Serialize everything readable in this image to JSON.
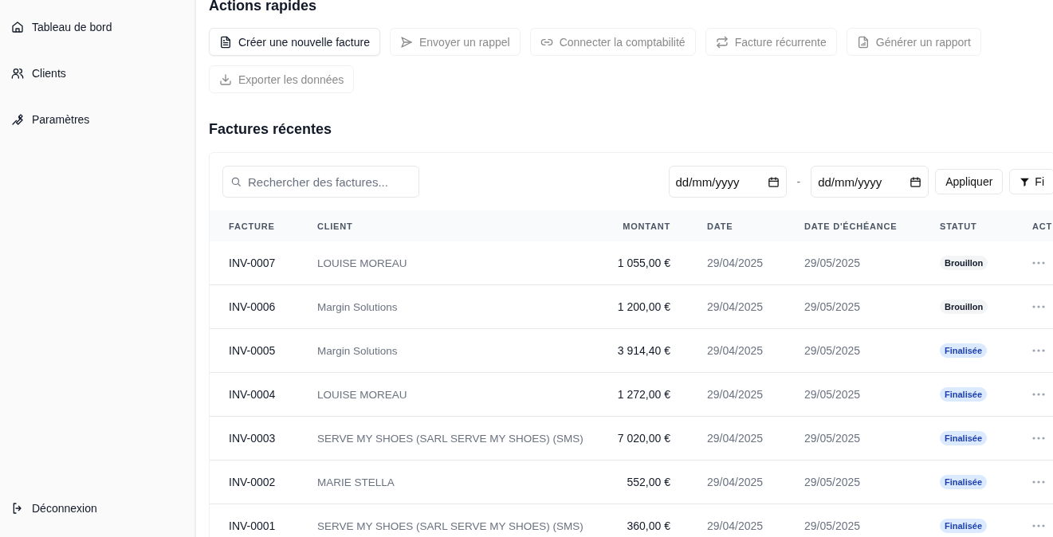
{
  "sidebar": {
    "items": [
      {
        "label": "Tableau de bord",
        "selected": false
      },
      {
        "label": "Clients",
        "selected": false
      },
      {
        "label": "Paramètres",
        "selected": false
      }
    ],
    "logout": "Déconnexion"
  },
  "quick_actions": {
    "title": "Actions rapides",
    "buttons": [
      {
        "label": "Créer une nouvelle facture",
        "disabled": false
      },
      {
        "label": "Envoyer un rappel",
        "disabled": true
      },
      {
        "label": "Connecter la comptabilité",
        "disabled": true
      },
      {
        "label": "Facture récurrente",
        "disabled": true
      },
      {
        "label": "Générer un rapport",
        "disabled": true
      },
      {
        "label": "Exporter les données",
        "disabled": true
      }
    ]
  },
  "recent_invoices": {
    "title": "Factures récentes",
    "search": {
      "placeholder": "Rechercher des factures..."
    },
    "date_from": {
      "placeholder": "dd/mm/yyyy"
    },
    "date_separator": "-",
    "date_to": {
      "placeholder": "dd/mm/yyyy"
    },
    "apply_button": "Appliquer",
    "filter_button": "Fi",
    "table": {
      "columns": [
        "FACTURE",
        "CLIENT",
        "MONTANT",
        "DATE",
        "DATE D'ÉCHÉANCE",
        "STATUT",
        "ACT"
      ],
      "rows": [
        {
          "invoice": "INV-0007",
          "client": "LOUISE MOREAU",
          "amount": "1 055,00 €",
          "date": "29/04/2025",
          "due": "29/05/2025",
          "status": "Brouillon",
          "kind": "draft"
        },
        {
          "invoice": "INV-0006",
          "client": "Margin Solutions",
          "amount": "1 200,00 €",
          "date": "29/04/2025",
          "due": "29/05/2025",
          "status": "Brouillon",
          "kind": "draft"
        },
        {
          "invoice": "INV-0005",
          "client": "Margin Solutions",
          "amount": "3 914,40 €",
          "date": "29/04/2025",
          "due": "29/05/2025",
          "status": "Finalisée",
          "kind": "final"
        },
        {
          "invoice": "INV-0004",
          "client": "LOUISE MOREAU",
          "amount": "1 272,00 €",
          "date": "29/04/2025",
          "due": "29/05/2025",
          "status": "Finalisée",
          "kind": "final"
        },
        {
          "invoice": "INV-0003",
          "client": "SERVE MY SHOES (SARL SERVE MY SHOES) (SMS)",
          "amount": "7 020,00 €",
          "date": "29/04/2025",
          "due": "29/05/2025",
          "status": "Finalisée",
          "kind": "final"
        },
        {
          "invoice": "INV-0002",
          "client": "MARIE STELLA",
          "amount": "552,00 €",
          "date": "29/04/2025",
          "due": "29/05/2025",
          "status": "Finalisée",
          "kind": "final"
        },
        {
          "invoice": "INV-0001",
          "client": "SERVE MY SHOES (SARL SERVE MY SHOES) (SMS)",
          "amount": "360,00 €",
          "date": "29/04/2025",
          "due": "29/05/2025",
          "status": "Finalisée",
          "kind": "final"
        }
      ]
    }
  }
}
